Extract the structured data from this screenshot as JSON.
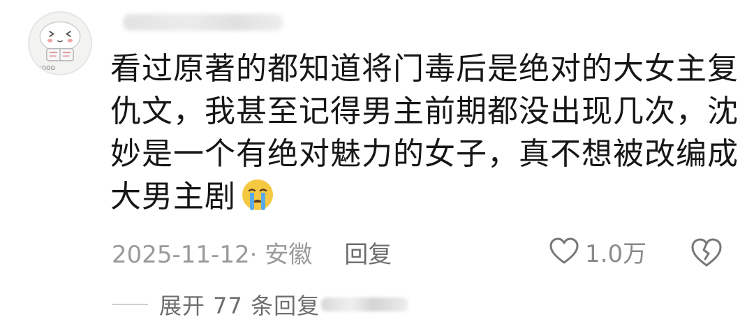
{
  "comment": {
    "lines": [
      "看过原著的都知道将门毒后是绝对的大女主复",
      "仇文，我甚至记得男主前期都没出现几次，沈",
      "妙是一个有绝对魅力的女子，真不想被改编成",
      "大男主剧"
    ],
    "emoji": "crying-face-emoji"
  },
  "meta": {
    "date_location": "2025-11-12· 安徽",
    "reply_label": "回复"
  },
  "like": {
    "count": "1.0万",
    "icon": "heart-outline-icon"
  },
  "dislike": {
    "icon": "broken-heart-icon"
  },
  "expand": {
    "label": "展开 77 条回复"
  },
  "colors": {
    "text": "#161616",
    "meta": "#9a9a9a",
    "reply": "#6d6d6d",
    "emoji_face": "#f5c842",
    "emoji_tear": "#5aa9e6"
  }
}
